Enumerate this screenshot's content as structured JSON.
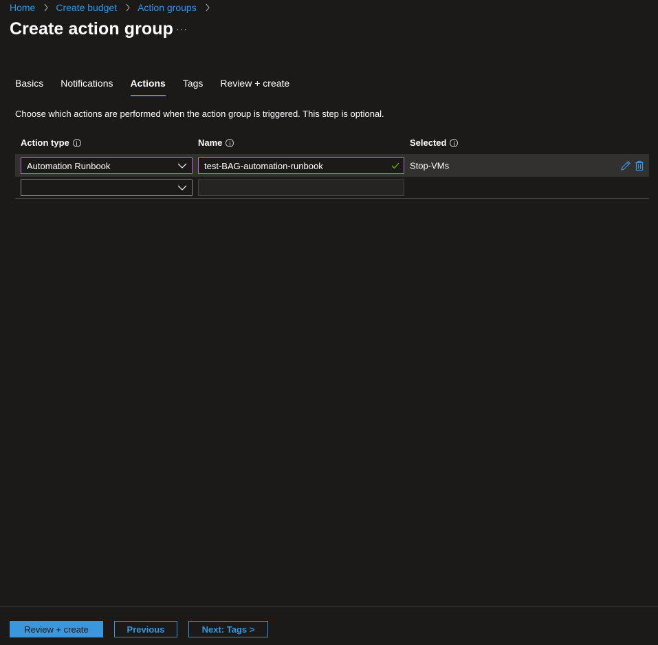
{
  "breadcrumb": [
    "Home",
    "Create budget",
    "Action groups"
  ],
  "page_title": "Create action group",
  "more_label": "···",
  "tabs": [
    {
      "label": "Basics",
      "active": false
    },
    {
      "label": "Notifications",
      "active": false
    },
    {
      "label": "Actions",
      "active": true
    },
    {
      "label": "Tags",
      "active": false
    },
    {
      "label": "Review + create",
      "active": false
    }
  ],
  "description": "Choose which actions are performed when the action group is triggered. This step is optional.",
  "columns": {
    "action_type": "Action type",
    "name": "Name",
    "selected": "Selected"
  },
  "rows": [
    {
      "action_type": "Automation Runbook",
      "name": "test-BAG-automation-runbook",
      "selected": "Stop-VMs",
      "valid": true
    },
    {
      "action_type": "",
      "name": "",
      "selected": ""
    }
  ],
  "footer": {
    "review_create": "Review + create",
    "previous": "Previous",
    "next": "Next: Tags >"
  },
  "colors": {
    "accent": "#3a96dd",
    "focus_border": "#b66bd1",
    "valid": "#6bb700",
    "background": "#1b1a19"
  },
  "icons": [
    "chevron-right-icon",
    "more-icon",
    "info-icon",
    "chevron-down-icon",
    "checkmark-icon",
    "edit-icon",
    "delete-icon"
  ]
}
